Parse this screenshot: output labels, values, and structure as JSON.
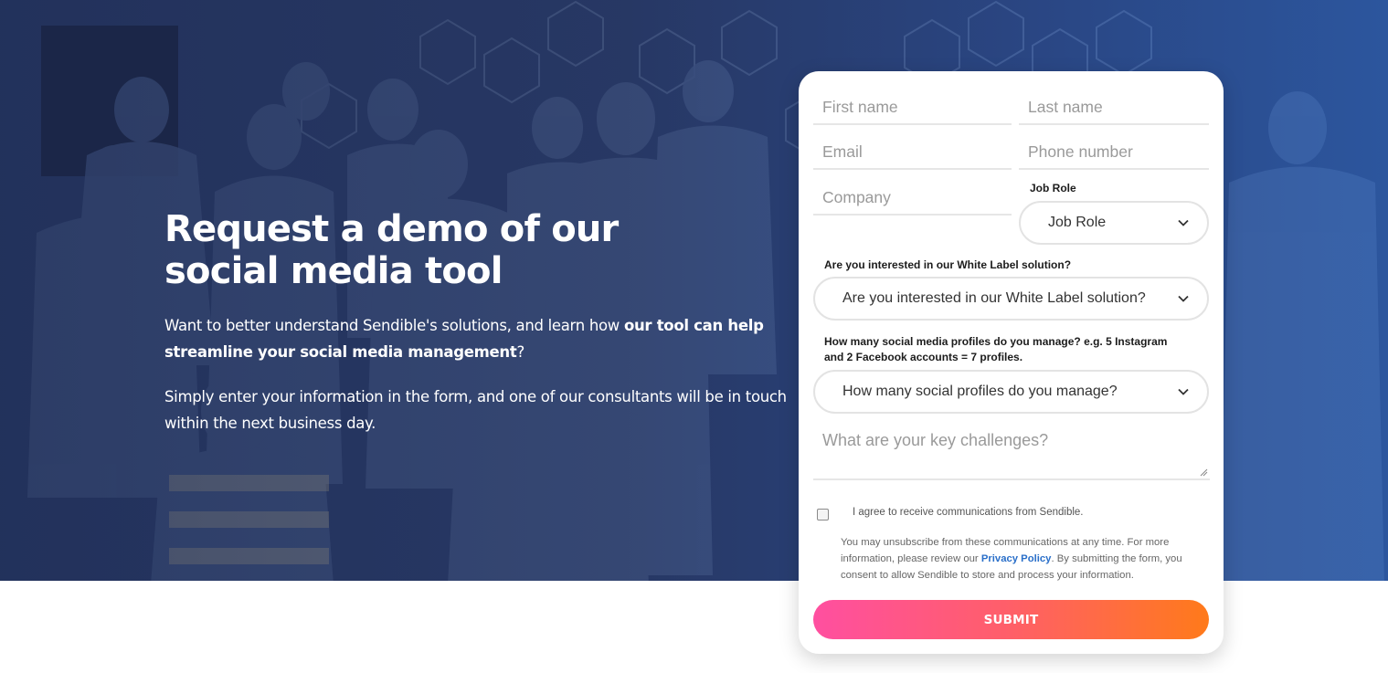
{
  "hero": {
    "title": "Request a demo of our social media tool",
    "intro_before": "Want to better understand Sendible's solutions, and learn how ",
    "intro_bold": "our tool can help streamline your social media management",
    "intro_after": "?",
    "paragraph2": "Simply enter your information in the form, and one of our consultants will be in touch within the next business day."
  },
  "form": {
    "first_name_placeholder": "First name",
    "last_name_placeholder": "Last name",
    "email_placeholder": "Email",
    "phone_placeholder": "Phone number",
    "company_placeholder": "Company",
    "job_role_label": "Job Role",
    "job_role_value": "Job Role",
    "white_label_label": "Are you interested in our White Label solution?",
    "white_label_value": "Are you interested in our White Label solution?",
    "profiles_label": "How many social media profiles do you manage? e.g. 5 Instagram and 2 Facebook accounts = 7 profiles.",
    "profiles_value": "How many social profiles do you manage?",
    "challenges_placeholder": "What are your key challenges?",
    "consent_label": "I agree to receive communications from Sendible.",
    "legal_before": "You may unsubscribe from these communications at any time. For more information, please review our ",
    "privacy_link": "Privacy Policy",
    "legal_after": ". By submitting the form, you consent to allow Sendible to store and process your information.",
    "submit_label": "SUBMIT"
  },
  "colors": {
    "hero_dark": "#1e2c56",
    "hero_blue": "#3278d7",
    "submit_start": "#ff4fa0",
    "submit_end": "#ff7a1a",
    "link": "#2a6fc9"
  }
}
